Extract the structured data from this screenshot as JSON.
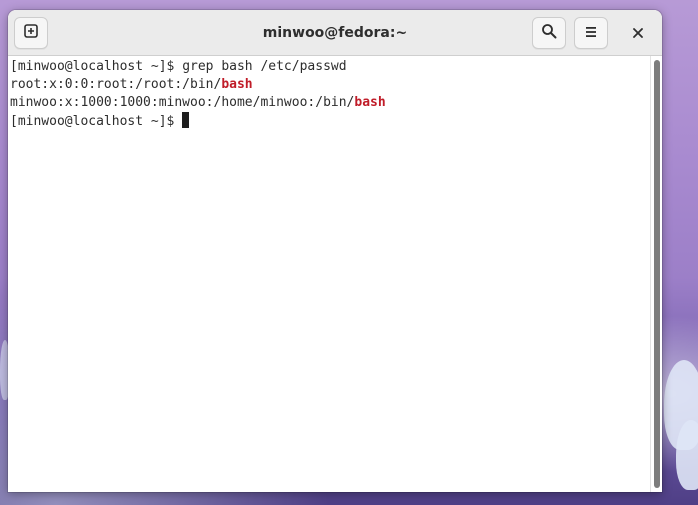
{
  "window": {
    "title": "minwoo@fedora:~"
  },
  "headerbar": {
    "new_tab_icon": "new-tab-icon",
    "search_icon": "search-icon",
    "menu_icon": "hamburger-menu-icon",
    "close_icon": "close-icon"
  },
  "terminal": {
    "line1": {
      "prompt": "[minwoo@localhost ~]$ ",
      "command": "grep bash /etc/passwd"
    },
    "line2": {
      "before": "root:x:0:0:root:/root:/bin/",
      "match": "bash"
    },
    "line3": {
      "before": "minwoo:x:1000:1000:minwoo:/home/minwoo:/bin/",
      "match": "bash"
    },
    "line4": {
      "prompt": "[minwoo@localhost ~]$ "
    },
    "colors": {
      "background": "#ffffff",
      "foreground": "#2d2d2d",
      "match": "#c01c28"
    }
  }
}
